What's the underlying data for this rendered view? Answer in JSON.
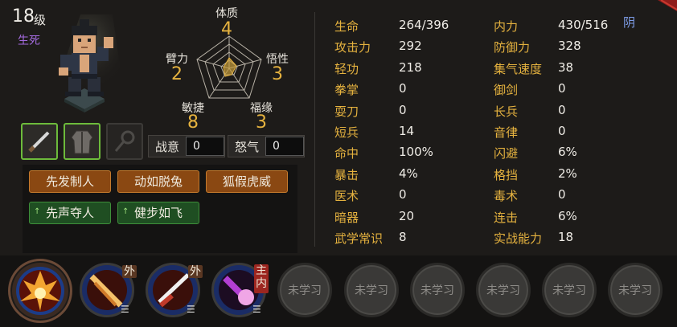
{
  "character": {
    "level": "18",
    "level_unit": "级",
    "status": "生死"
  },
  "attributes": [
    {
      "key": "constitution",
      "name": "体质",
      "value": "4"
    },
    {
      "key": "strength",
      "name": "臂力",
      "value": "2"
    },
    {
      "key": "insight",
      "name": "悟性",
      "value": "3"
    },
    {
      "key": "agility",
      "name": "敏捷",
      "value": "8"
    },
    {
      "key": "luck",
      "name": "福缘",
      "value": "3"
    }
  ],
  "meters": {
    "fighting_spirit_label": "战意",
    "fighting_spirit_value": "0",
    "rage_label": "怒气",
    "rage_value": "0"
  },
  "traits": [
    {
      "label": "先发制人",
      "style": "orange"
    },
    {
      "label": "动如脱兔",
      "style": "orange"
    },
    {
      "label": "狐假虎威",
      "style": "orange"
    },
    {
      "label": "先声夺人",
      "style": "green",
      "up_marker": "↑"
    },
    {
      "label": "健步如飞",
      "style": "green",
      "up_marker": "↑"
    }
  ],
  "stats_left": [
    {
      "label": "生命",
      "value": "264/396"
    },
    {
      "label": "攻击力",
      "value": "292"
    },
    {
      "label": "轻功",
      "value": "218"
    },
    {
      "label": "拳掌",
      "value": "0"
    },
    {
      "label": "耍刀",
      "value": "0"
    },
    {
      "label": "短兵",
      "value": "14"
    },
    {
      "label": "命中",
      "value": "100%"
    },
    {
      "label": "暴击",
      "value": "4%"
    },
    {
      "label": "医术",
      "value": "0"
    },
    {
      "label": "暗器",
      "value": "20"
    },
    {
      "label": "武学常识",
      "value": "8"
    }
  ],
  "stats_right": [
    {
      "label": "内力",
      "value": "430/516"
    },
    {
      "label": "防御力",
      "value": "328"
    },
    {
      "label": "集气速度",
      "value": "38"
    },
    {
      "label": "御剑",
      "value": "0"
    },
    {
      "label": "长兵",
      "value": "0"
    },
    {
      "label": "音律",
      "value": "0"
    },
    {
      "label": "闪避",
      "value": "6%"
    },
    {
      "label": "格挡",
      "value": "2%"
    },
    {
      "label": "毒术",
      "value": "0"
    },
    {
      "label": "连击",
      "value": "6%"
    },
    {
      "label": "实战能力",
      "value": "18"
    }
  ],
  "alignment": "阴",
  "skills": {
    "tags": [
      "外",
      "外",
      "主",
      "内"
    ],
    "locked_label": "未学习"
  },
  "colors": {
    "gold": "#e5b23f",
    "purple": "#a56be0",
    "green_border": "#6dbb3b",
    "blue": "#7f9ee9"
  }
}
